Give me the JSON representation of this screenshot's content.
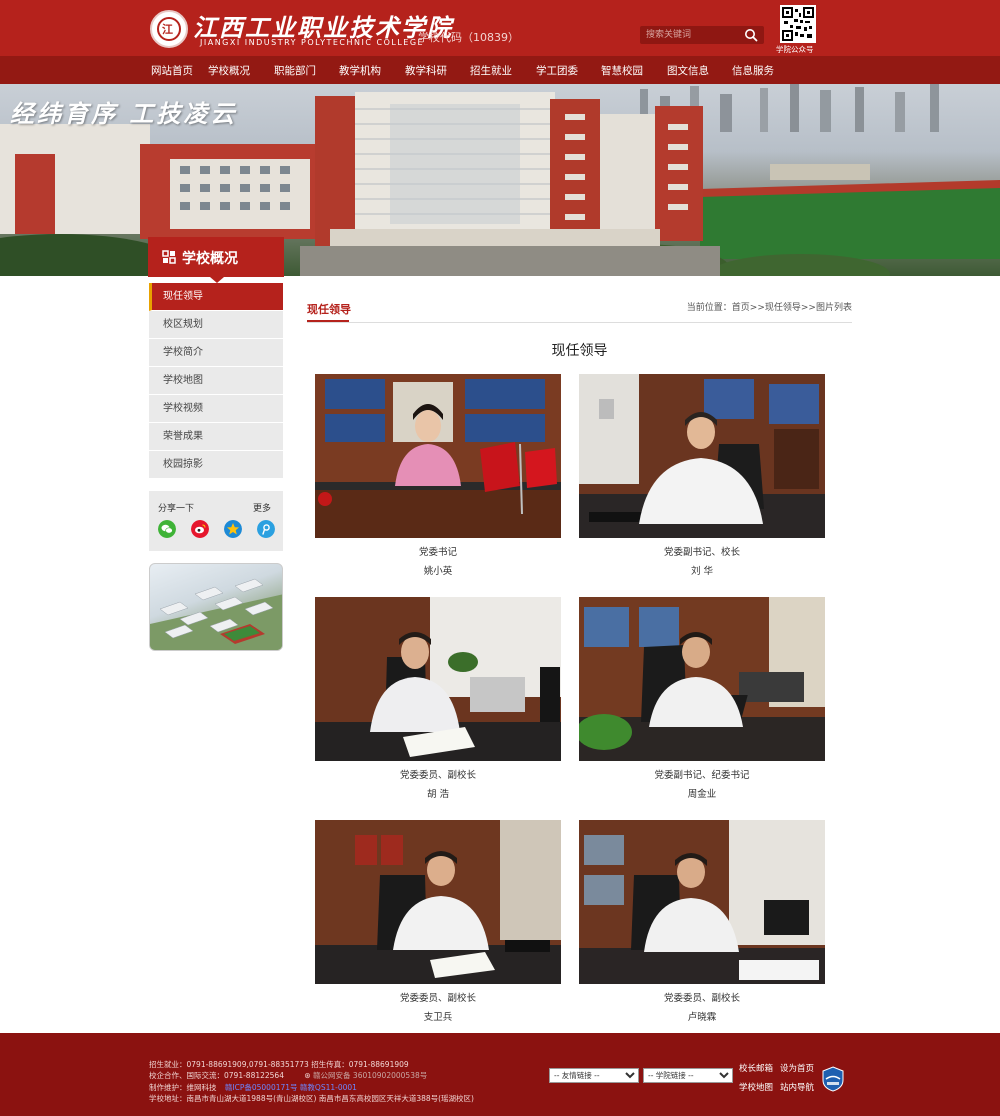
{
  "header": {
    "logo_mark": "江",
    "logo_cn": "江西工业职业技术学院",
    "logo_en": "JIANGXI INDUSTRY POLYTECHNIC COLLEGE",
    "school_code": "学校代码（10839）",
    "search_placeholder": "搜索关键词",
    "qr_label": "学院公众号"
  },
  "nav": {
    "items": [
      "网站首页",
      "学校概况",
      "职能部门",
      "教学机构",
      "教学科研",
      "招生就业",
      "学工团委",
      "智慧校园",
      "图文信息",
      "信息服务"
    ]
  },
  "banner": {
    "slogan": "经纬育序 工技凌云"
  },
  "section": {
    "title": "学校概况"
  },
  "sidebar": {
    "items": [
      "现任领导",
      "校区规划",
      "学校简介",
      "学校地图",
      "学校视频",
      "荣誉成果",
      "校园掠影"
    ],
    "share_label": "分享一下",
    "share_more": "更多"
  },
  "main": {
    "tab_title": "现任领导",
    "breadcrumb_prefix": "当前位置：",
    "breadcrumb_home": "首页",
    "breadcrumb_sep": ">>",
    "breadcrumb_section": "现任领导",
    "breadcrumb_current": "图片列表",
    "heading": "现任领导",
    "leaders": [
      {
        "title": "党委书记",
        "name": "姚小英"
      },
      {
        "title": "党委副书记、校长",
        "name": "刘  华"
      },
      {
        "title": "党委委员、副校长",
        "name": "胡  浩"
      },
      {
        "title": "党委副书记、纪委书记",
        "name": "周金业"
      },
      {
        "title": "党委委员、副校长",
        "name": "支卫兵"
      },
      {
        "title": "党委委员、副校长",
        "name": "卢晓霖"
      }
    ]
  },
  "footer": {
    "line1": "招生就业：0791-88691909,0791-88351773   招生传真：0791-88691909",
    "line2": "校企合作、国际交流：0791-88122564",
    "police": "赣公网安备 36010902000538号",
    "line3_prefix": "制作维护：维网科技",
    "line3_link": "赣ICP备05000171号 赣教QS11-0001",
    "line4": "学校地址：南昌市青山湖大道1988号(青山湖校区)  南昌市昌东高校园区天祥大道388号(瑶湖校区)",
    "select_friend": "-- 友情链接 --",
    "select_school": "-- 学院链接 --",
    "links": [
      "校长邮箱",
      "设为首页",
      "学校地图",
      "站内导航"
    ]
  },
  "colors": {
    "brand_red": "#b5221c",
    "nav_red": "#931913",
    "footer_red": "#8b1210",
    "accent_gold": "#e8a200"
  }
}
